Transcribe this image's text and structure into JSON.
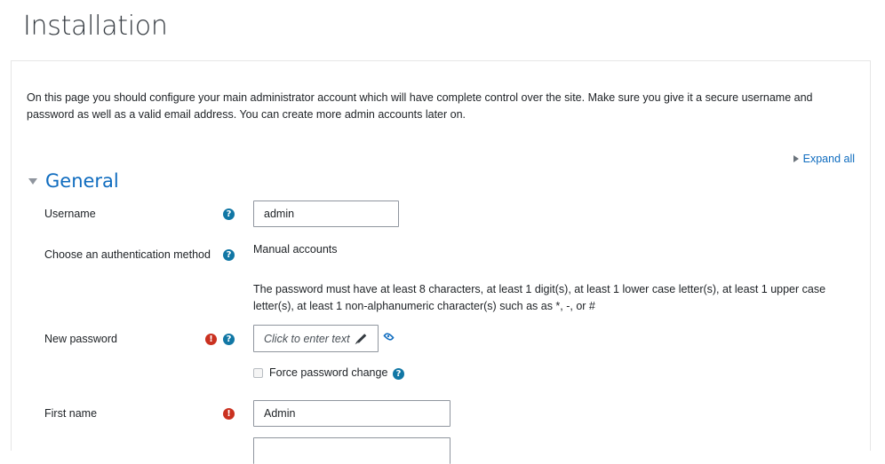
{
  "page": {
    "title": "Installation"
  },
  "intro_text": "On this page you should configure your main administrator account which will have complete control over the site. Make sure you give it a secure username and password as well as a valid email address. You can create more admin accounts later on.",
  "expand_all_label": "Expand all",
  "section": {
    "title": "General"
  },
  "fields": {
    "username": {
      "label": "Username",
      "value": "admin"
    },
    "auth": {
      "label": "Choose an authentication method",
      "value": "Manual accounts"
    },
    "password_rules": "The password must have at least 8 characters, at least 1 digit(s), at least 1 lower case letter(s), at least 1 upper case letter(s), at least 1 non-alphanumeric character(s) such as as *, -, or #",
    "new_password": {
      "label": "New password",
      "placeholder": "Click to enter text"
    },
    "force_change": {
      "label": "Force password change",
      "checked": false
    },
    "first_name": {
      "label": "First name",
      "value": "Admin"
    }
  },
  "icons": {
    "help": "question-circle-icon",
    "required": "exclamation-circle-icon",
    "reveal": "eye-icon",
    "edit": "pencil-icon"
  },
  "colors": {
    "link": "#0f6cbf",
    "help": "#1177a5",
    "required": "#ca3120"
  }
}
